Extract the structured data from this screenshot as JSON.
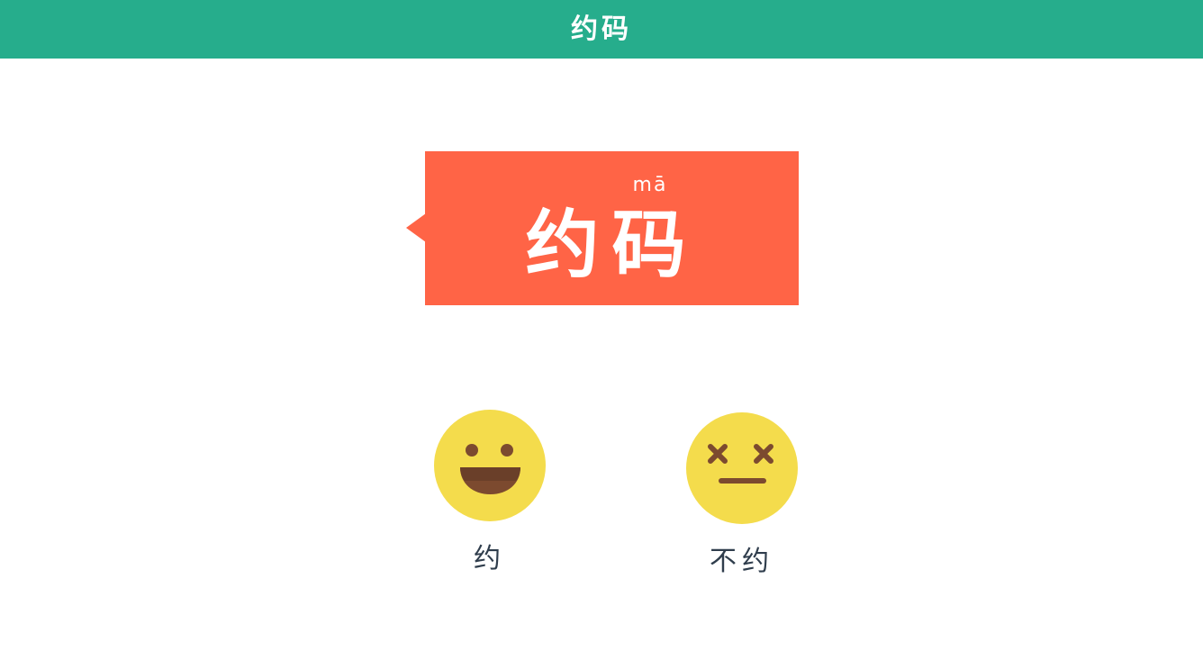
{
  "header": {
    "title": "约码"
  },
  "card": {
    "pinyin": "mā",
    "word": "约码",
    "color": "#ff6446"
  },
  "choices": [
    {
      "label": "约",
      "icon": "smiley-face-icon"
    },
    {
      "label": "不约",
      "icon": "dizzy-face-icon"
    }
  ],
  "colors": {
    "header": "#26ad8c",
    "face": "#f4dc4c",
    "face_feature": "#7c4a2f",
    "label_text": "#2f3d4c"
  }
}
